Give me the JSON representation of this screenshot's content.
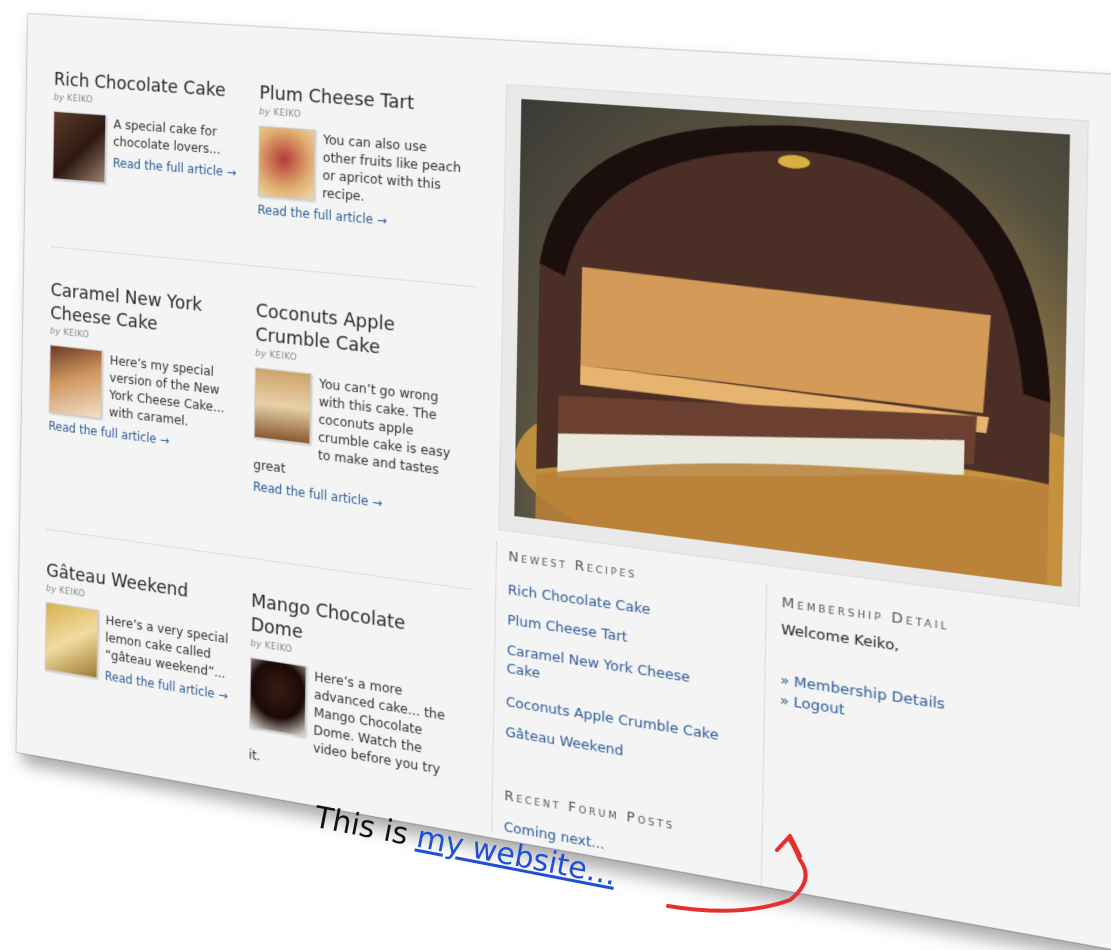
{
  "posts": [
    {
      "title": "Rich Chocolate Cake",
      "byline": "KEIKO",
      "excerpt": "A special cake for chocolate lovers...",
      "more": "Read the full article →"
    },
    {
      "title": "Plum Cheese Tart",
      "byline": "KEIKO",
      "excerpt": "You can also use other fruits like peach or apricot with this recipe.",
      "more": "Read the full article →"
    },
    {
      "title": "Caramel New York Cheese Cake",
      "byline": "KEIKO",
      "excerpt": "Here’s my special version of the New York Cheese Cake... with caramel.",
      "more": "Read the full article →"
    },
    {
      "title": "Coconuts Apple Crumble Cake",
      "byline": "KEIKO",
      "excerpt": "You can’t go wrong with this cake. The coconuts apple crumble cake is easy to make and tastes great",
      "more": "Read the full article →"
    },
    {
      "title": "Gâteau Weekend",
      "byline": "KEIKO",
      "excerpt": "Here’s a very special lemon cake called “gâteau weekend”...",
      "more": "Read the full article →"
    },
    {
      "title": "Mango Chocolate Dome",
      "byline": "KEIKO",
      "excerpt": "Here’s a more advanced cake... the Mango Chocolate Dome. Watch the video before you try it.",
      "more": ""
    }
  ],
  "byline_prefix": "by",
  "sidebar": {
    "newest_heading": "Newest Recipes",
    "newest": [
      "Rich Chocolate Cake",
      "Plum Cheese Tart",
      "Caramel New York Cheese Cake",
      "Coconuts Apple Crumble Cake",
      "Gâteau Weekend"
    ],
    "forum_heading": "Recent Forum Posts",
    "forum_text": "Coming next..."
  },
  "membership": {
    "heading": "Membership Detail",
    "welcome": "Welcome Keiko,",
    "links": [
      "» Membership Details",
      "» Logout"
    ]
  },
  "caption": {
    "prefix": "This is ",
    "link": "my website…"
  },
  "colors": {
    "link": "#2d5c9a",
    "caption_link": "#1f4fd6",
    "arrow": "#e53030"
  }
}
